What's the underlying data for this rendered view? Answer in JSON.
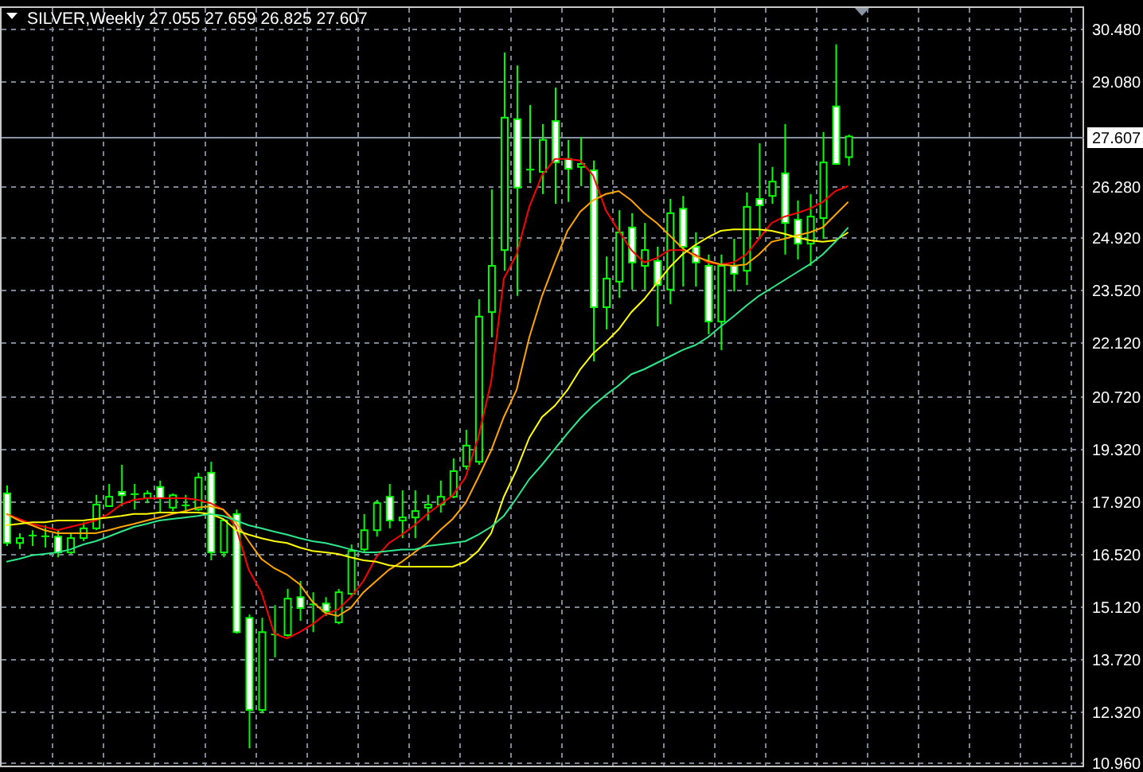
{
  "chart": {
    "header": {
      "ohlc": [
        "27.055",
        "27.659",
        "26.825",
        "27.607"
      ]
    },
    "chart_data": {
      "type": "candlestick",
      "title": "SILVER,Weekly",
      "grid": true,
      "categories": [
        null,
        null,
        null,
        null,
        null,
        null,
        null,
        null,
        null,
        null,
        null,
        null,
        null,
        null,
        null,
        null,
        null,
        null,
        null,
        null,
        null,
        null,
        null,
        null,
        null,
        null,
        null,
        null,
        null,
        null,
        null,
        null,
        null,
        null,
        null,
        null,
        null,
        null,
        null,
        null,
        null,
        null,
        null,
        null,
        null,
        null,
        null,
        null,
        null,
        null,
        null,
        null,
        null,
        null,
        null,
        null,
        null,
        null,
        null,
        null,
        null,
        null,
        null,
        null,
        null,
        null,
        null,
        null,
        null,
        null,
        null,
        null,
        null,
        null,
        null,
        null,
        null,
        null,
        null,
        null,
        null,
        null,
        null,
        null,
        null
      ],
      "ylim": [
        10.88,
        31.07
      ],
      "yticks": [
        {
          "value": 30.48,
          "label": "30.480"
        },
        {
          "value": 29.08,
          "label": "29.080"
        },
        {
          "value": 26.28,
          "label": "26.280"
        },
        {
          "value": 24.92,
          "label": "24.920"
        },
        {
          "value": 23.52,
          "label": "23.520"
        },
        {
          "value": 22.12,
          "label": "22.120"
        },
        {
          "value": 20.72,
          "label": "20.720"
        },
        {
          "value": 19.32,
          "label": "19.320"
        },
        {
          "value": 17.92,
          "label": "17.920"
        },
        {
          "value": 16.52,
          "label": "16.520"
        },
        {
          "value": 15.12,
          "label": "15.120"
        },
        {
          "value": 13.72,
          "label": "13.720"
        },
        {
          "value": 12.32,
          "label": "12.320"
        },
        {
          "value": 10.96,
          "label": "10.960"
        }
      ],
      "ohlc": [
        [
          18.12,
          18.33,
          16.72,
          16.8
        ],
        [
          16.8,
          17.06,
          16.64,
          16.93
        ],
        [
          16.97,
          17.14,
          16.72,
          17.02
        ],
        [
          16.97,
          17.27,
          16.68,
          17.0
        ],
        [
          16.97,
          17.14,
          16.42,
          16.55
        ],
        [
          16.55,
          17.06,
          16.51,
          16.93
        ],
        [
          16.93,
          17.35,
          16.85,
          17.19
        ],
        [
          17.19,
          18.08,
          17.14,
          17.82
        ],
        [
          17.78,
          18.37,
          17.78,
          18.03
        ],
        [
          18.16,
          18.88,
          17.78,
          18.07
        ],
        [
          18.07,
          18.37,
          17.69,
          18.12
        ],
        [
          17.99,
          18.2,
          17.86,
          18.12
        ],
        [
          18.29,
          18.46,
          17.61,
          17.99
        ],
        [
          17.74,
          18.12,
          17.65,
          18.07
        ],
        [
          17.78,
          18.08,
          17.65,
          17.82
        ],
        [
          17.69,
          18.67,
          17.65,
          18.54
        ],
        [
          18.67,
          18.96,
          16.34,
          16.55
        ],
        [
          16.55,
          17.44,
          16.42,
          17.4
        ],
        [
          17.57,
          17.69,
          14.39,
          14.43
        ],
        [
          14.81,
          14.9,
          11.34,
          12.36
        ],
        [
          12.36,
          14.81,
          12.27,
          14.43
        ],
        [
          14.35,
          15.15,
          13.76,
          14.39
        ],
        [
          14.35,
          15.58,
          14.31,
          15.32
        ],
        [
          15.36,
          15.79,
          14.73,
          15.07
        ],
        [
          15.15,
          15.49,
          14.43,
          15.19
        ],
        [
          15.19,
          15.36,
          14.86,
          14.98
        ],
        [
          14.69,
          15.58,
          14.64,
          15.49
        ],
        [
          15.45,
          16.76,
          15.36,
          16.59
        ],
        [
          16.63,
          17.57,
          16.55,
          17.14
        ],
        [
          17.14,
          17.95,
          16.97,
          17.86
        ],
        [
          18.03,
          18.37,
          17.19,
          17.4
        ],
        [
          17.4,
          18.2,
          16.93,
          17.48
        ],
        [
          17.48,
          18.2,
          16.93,
          17.65
        ],
        [
          17.74,
          18.08,
          17.4,
          17.82
        ],
        [
          17.82,
          18.46,
          17.61,
          18.03
        ],
        [
          18.03,
          19.05,
          17.99,
          18.71
        ],
        [
          18.84,
          19.81,
          18.75,
          19.39
        ],
        [
          18.96,
          23.28,
          18.88,
          22.82
        ],
        [
          22.94,
          26.2,
          22.27,
          24.17
        ],
        [
          24.59,
          29.84,
          24.04,
          28.11
        ],
        [
          28.07,
          29.5,
          23.37,
          26.25
        ],
        [
          26.71,
          28.45,
          26.37,
          26.75
        ],
        [
          26.67,
          27.94,
          26.08,
          27.52
        ],
        [
          28.02,
          28.91,
          25.82,
          26.92
        ],
        [
          27.01,
          27.52,
          25.87,
          26.75
        ],
        [
          26.8,
          27.6,
          26.29,
          26.88
        ],
        [
          26.71,
          26.97,
          21.63,
          23.07
        ],
        [
          23.07,
          24.42,
          22.48,
          23.83
        ],
        [
          23.75,
          25.65,
          23.32,
          25.06
        ],
        [
          25.19,
          25.57,
          23.54,
          24.26
        ],
        [
          24.17,
          25.31,
          23.54,
          24.59
        ],
        [
          24.3,
          24.68,
          22.56,
          23.66
        ],
        [
          23.54,
          25.95,
          23.15,
          25.57
        ],
        [
          25.69,
          26.03,
          23.62,
          24.68
        ],
        [
          24.68,
          25.06,
          23.62,
          24.26
        ],
        [
          24.17,
          24.47,
          22.35,
          22.69
        ],
        [
          22.69,
          24.47,
          21.93,
          24.17
        ],
        [
          24.17,
          24.89,
          23.49,
          23.96
        ],
        [
          24.04,
          26.12,
          23.66,
          25.74
        ],
        [
          25.95,
          27.43,
          24.89,
          25.78
        ],
        [
          26.03,
          26.8,
          25.82,
          26.41
        ],
        [
          26.63,
          27.94,
          24.47,
          25.31
        ],
        [
          25.4,
          25.91,
          24.34,
          24.76
        ],
        [
          24.76,
          26.08,
          24.17,
          25.48
        ],
        [
          25.44,
          27.73,
          24.89,
          26.92
        ],
        [
          28.41,
          30.06,
          26.88,
          26.88
        ],
        [
          27.06,
          27.66,
          26.83,
          27.61
        ],
        null,
        null,
        null,
        null,
        null,
        null,
        null,
        null,
        null,
        null,
        null,
        null,
        null,
        null,
        null,
        null,
        null,
        null
      ],
      "series": [
        {
          "type": "line",
          "color": "#ff0000",
          "values": [
            17.57,
            17.44,
            17.31,
            17.23,
            17.14,
            17.23,
            17.31,
            17.4,
            17.57,
            17.82,
            17.95,
            17.99,
            17.99,
            17.99,
            17.99,
            17.95,
            17.86,
            17.69,
            17.23,
            16.09,
            15.49,
            14.39,
            14.26,
            14.43,
            14.64,
            14.9,
            15.03,
            15.36,
            15.79,
            16.42,
            16.8,
            17.02,
            17.27,
            17.57,
            17.82,
            18.07,
            18.54,
            19.6,
            21.08,
            23.83,
            24.47,
            25.74,
            26.58,
            27.01,
            27.01,
            26.97,
            26.58,
            25.65,
            25.1,
            24.59,
            24.26,
            24.38,
            24.59,
            24.59,
            24.47,
            24.26,
            24.21,
            24.26,
            24.47,
            24.89,
            25.31,
            25.48,
            25.57,
            25.69,
            25.87,
            26.16,
            26.29,
            null,
            null,
            null,
            null,
            null,
            null,
            null,
            null,
            null,
            null,
            null,
            null,
            null,
            null,
            null,
            null,
            null,
            null
          ]
        },
        {
          "type": "line",
          "color": "#ffa500",
          "values": [
            17.57,
            17.4,
            17.27,
            17.14,
            17.06,
            17.06,
            17.06,
            17.06,
            17.14,
            17.23,
            17.31,
            17.4,
            17.48,
            17.57,
            17.65,
            17.74,
            17.78,
            17.69,
            17.35,
            16.85,
            16.38,
            16.13,
            15.96,
            15.7,
            15.24,
            14.94,
            14.86,
            15.07,
            15.49,
            15.79,
            16.09,
            16.3,
            16.55,
            16.8,
            17.14,
            17.44,
            17.86,
            18.54,
            19.26,
            20.15,
            20.87,
            22.27,
            23.37,
            24.26,
            25.1,
            25.61,
            25.91,
            26.08,
            26.16,
            25.91,
            25.57,
            25.31,
            24.98,
            24.64,
            24.42,
            24.3,
            24.21,
            24.17,
            24.21,
            24.47,
            24.81,
            24.89,
            24.98,
            25.06,
            25.19,
            25.53,
            25.87,
            null,
            null,
            null,
            null,
            null,
            null,
            null,
            null,
            null,
            null,
            null,
            null,
            null,
            null,
            null,
            null,
            null,
            null
          ]
        },
        {
          "type": "line",
          "color": "#ffff00",
          "values": [
            17.27,
            17.31,
            17.35,
            17.35,
            17.4,
            17.4,
            17.4,
            17.44,
            17.48,
            17.52,
            17.57,
            17.57,
            17.61,
            17.61,
            17.61,
            17.61,
            17.57,
            17.44,
            17.14,
            17.02,
            16.93,
            16.85,
            16.8,
            16.68,
            16.59,
            16.55,
            16.51,
            16.42,
            16.34,
            16.3,
            16.21,
            16.17,
            16.17,
            16.17,
            16.17,
            16.17,
            16.3,
            16.59,
            17.06,
            18.03,
            18.75,
            19.6,
            20.15,
            20.45,
            20.87,
            21.42,
            21.84,
            22.14,
            22.48,
            22.94,
            23.28,
            23.71,
            24.13,
            24.47,
            24.72,
            24.93,
            25.1,
            25.14,
            25.14,
            25.14,
            25.1,
            25.02,
            24.93,
            24.85,
            24.81,
            24.85,
            25.06,
            null,
            null,
            null,
            null,
            null,
            null,
            null,
            null,
            null,
            null,
            null,
            null,
            null,
            null,
            null,
            null,
            null,
            null
          ]
        },
        {
          "type": "line",
          "color": "#2ee88a",
          "values": [
            16.3,
            16.38,
            16.47,
            16.51,
            16.55,
            16.63,
            16.76,
            16.85,
            16.97,
            17.1,
            17.23,
            17.31,
            17.4,
            17.44,
            17.48,
            17.52,
            17.57,
            17.52,
            17.4,
            17.27,
            17.19,
            17.1,
            17.02,
            16.93,
            16.85,
            16.8,
            16.72,
            16.63,
            16.55,
            16.55,
            16.59,
            16.63,
            16.63,
            16.72,
            16.76,
            16.8,
            16.85,
            17.02,
            17.23,
            17.52,
            17.99,
            18.5,
            18.88,
            19.3,
            19.72,
            20.11,
            20.45,
            20.74,
            20.99,
            21.29,
            21.42,
            21.59,
            21.76,
            21.93,
            22.06,
            22.27,
            22.56,
            22.82,
            23.11,
            23.37,
            23.58,
            23.79,
            24.0,
            24.21,
            24.47,
            24.81,
            25.19,
            null,
            null,
            null,
            null,
            null,
            null,
            null,
            null,
            null,
            null,
            null,
            null,
            null,
            null,
            null,
            null,
            null,
            null
          ]
        }
      ],
      "ref_lines": [
        {
          "axis": "y",
          "value": 27.607,
          "label": "27.607"
        }
      ]
    }
  }
}
